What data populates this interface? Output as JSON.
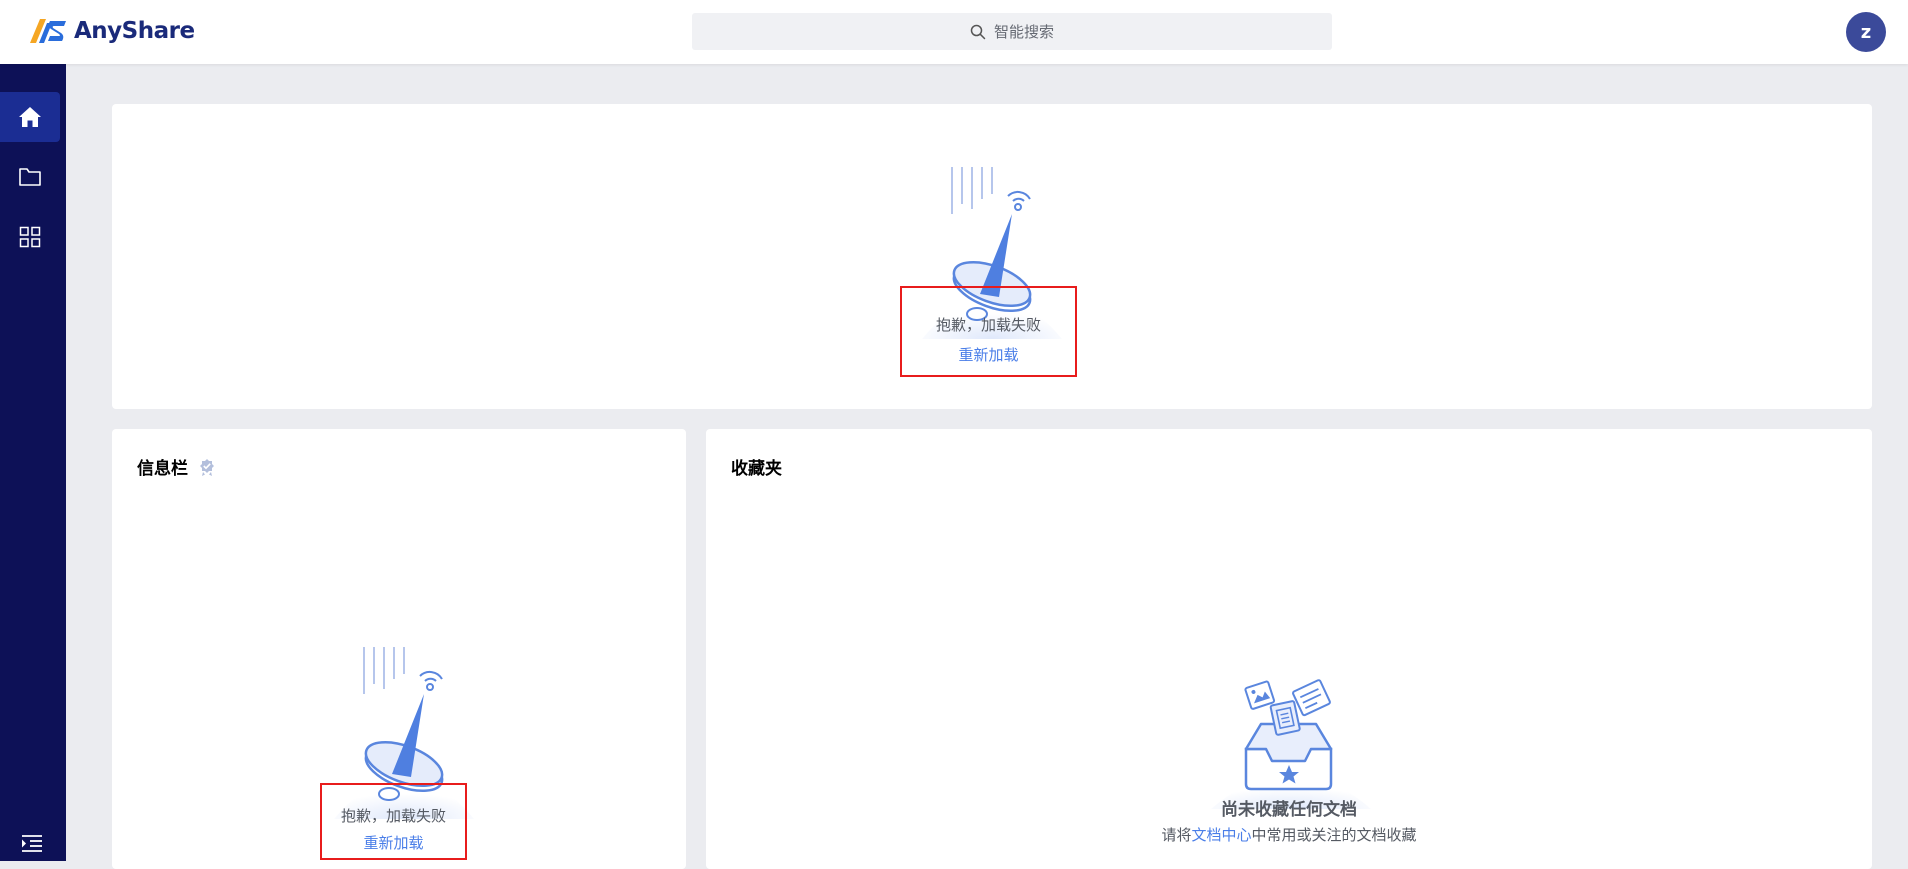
{
  "header": {
    "brand": "AnyShare",
    "search_placeholder": "智能搜索",
    "avatar_initial": "z"
  },
  "sidebar": {
    "items": [
      {
        "name": "home",
        "icon": "home-icon",
        "active": true
      },
      {
        "name": "documents",
        "icon": "folder-icon",
        "active": false
      },
      {
        "name": "apps",
        "icon": "grid-icon",
        "active": false
      }
    ]
  },
  "top_card": {
    "error_message": "抱歉，加载失败",
    "reload_label": "重新加载"
  },
  "info_card": {
    "title": "信息栏",
    "error_message": "抱歉，加载失败",
    "reload_label": "重新加载"
  },
  "favorites_card": {
    "title": "收藏夹",
    "empty_title": "尚未收藏任何文档",
    "hint_prefix": "请将",
    "hint_link": "文档中心",
    "hint_suffix": "中常用或关注的文档收藏"
  },
  "colors": {
    "sidebar_bg": "#0d1157",
    "sidebar_active": "#1b2d93",
    "accent": "#4a7ee8",
    "error_outline": "#e81c1c"
  }
}
